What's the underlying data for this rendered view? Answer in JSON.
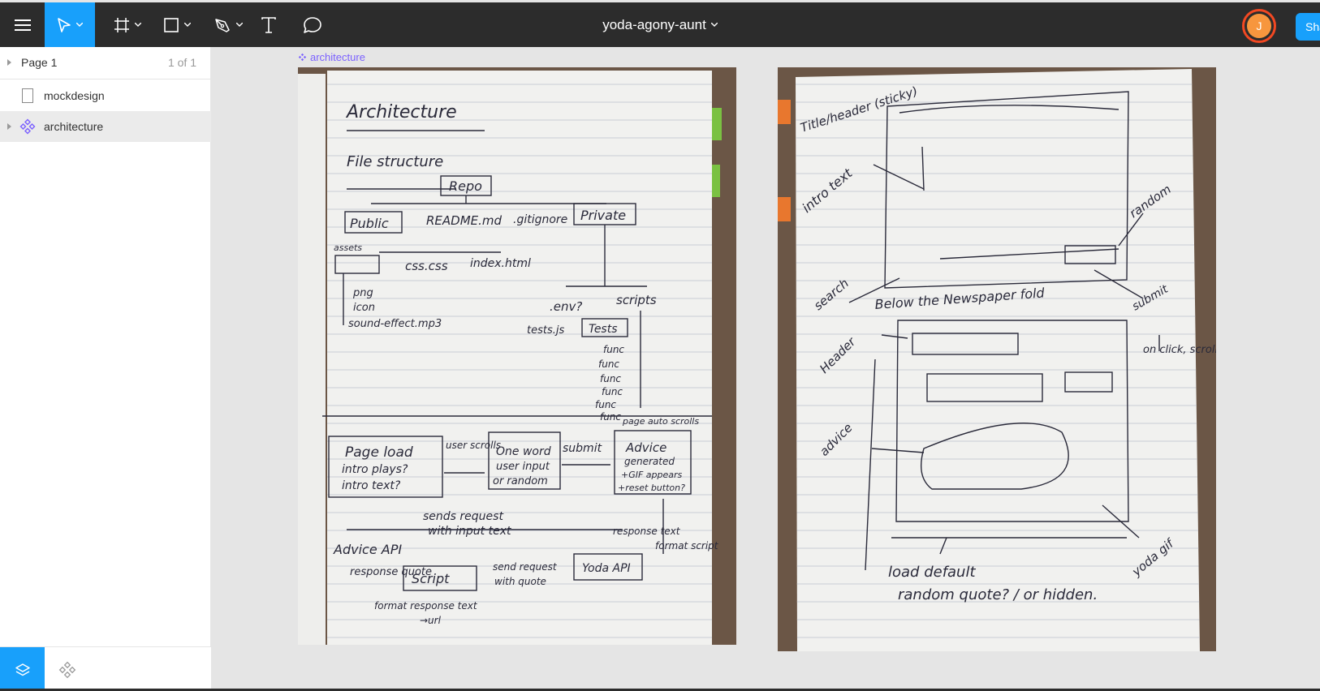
{
  "toolbar": {
    "file_name": "yoda-agony-aunt",
    "share_label": "Share",
    "avatar_initial": "J",
    "accent_color": "#18a0fb",
    "avatar_ring_color": "#f24822",
    "icons": {
      "menu": "hamburger-menu-icon",
      "move": "move-cursor-icon",
      "frame": "frame-icon",
      "shape": "rectangle-icon",
      "pen": "pen-icon",
      "text": "text-icon",
      "comment": "comment-icon"
    }
  },
  "sidebar": {
    "page": {
      "name": "Page 1",
      "count": "1 of 1"
    },
    "layers": [
      {
        "name": "mockdesign",
        "type": "frame",
        "selected": false
      },
      {
        "name": "architecture",
        "type": "component",
        "selected": true
      }
    ]
  },
  "canvas": {
    "frame_label": "architecture",
    "left_sketch": {
      "heading": "Architecture",
      "subheading": "File structure",
      "repo": "Repo",
      "public": "Public",
      "readme": "README.md",
      "gitignore": ".gitignore",
      "private": "Private",
      "assets": "assets",
      "css": "css.css",
      "index": "index.html",
      "png": "png",
      "icon": "icon",
      "sound": "sound-effect.mp3",
      "env": ".env?",
      "scripts": "scripts",
      "testsjs": "tests.js",
      "tests": "Tests",
      "func": "func",
      "page_load_1": "Page load",
      "page_load_2": "intro plays?",
      "page_load_3": "intro text?",
      "user_scrolls": "user scrolls",
      "one_word_1": "One word",
      "one_word_2": "user input",
      "one_word_3": "or random",
      "submit": "submit",
      "advice_1": "Advice",
      "advice_2": "generated",
      "advice_3": "+GIF appears",
      "advice_4": "+reset button?",
      "page_auto": "page auto scrolls",
      "sends_request_1": "sends request",
      "sends_request_2": "with input text",
      "advice_api": "Advice API",
      "response_quote": "response quote",
      "script": "Script",
      "send_request_1": "send request",
      "send_request_2": "with quote",
      "yoda_api": "Yoda API",
      "response_text": "response text",
      "format_script": "format script",
      "format_response_1": "format response text",
      "format_response_2": "→url"
    },
    "right_sketch": {
      "title_header": "Title/header (sticky)",
      "intro_text": "intro text",
      "random": "random",
      "search": "search",
      "submit": "submit",
      "below_fold": "Below the Newspaper fold",
      "header": "Header",
      "on_click": "on click, scroll",
      "advice": "advice",
      "load_default_1": "load default",
      "load_default_2": "random quote? / or hidden.",
      "yoda_gif": "yoda gif"
    }
  }
}
